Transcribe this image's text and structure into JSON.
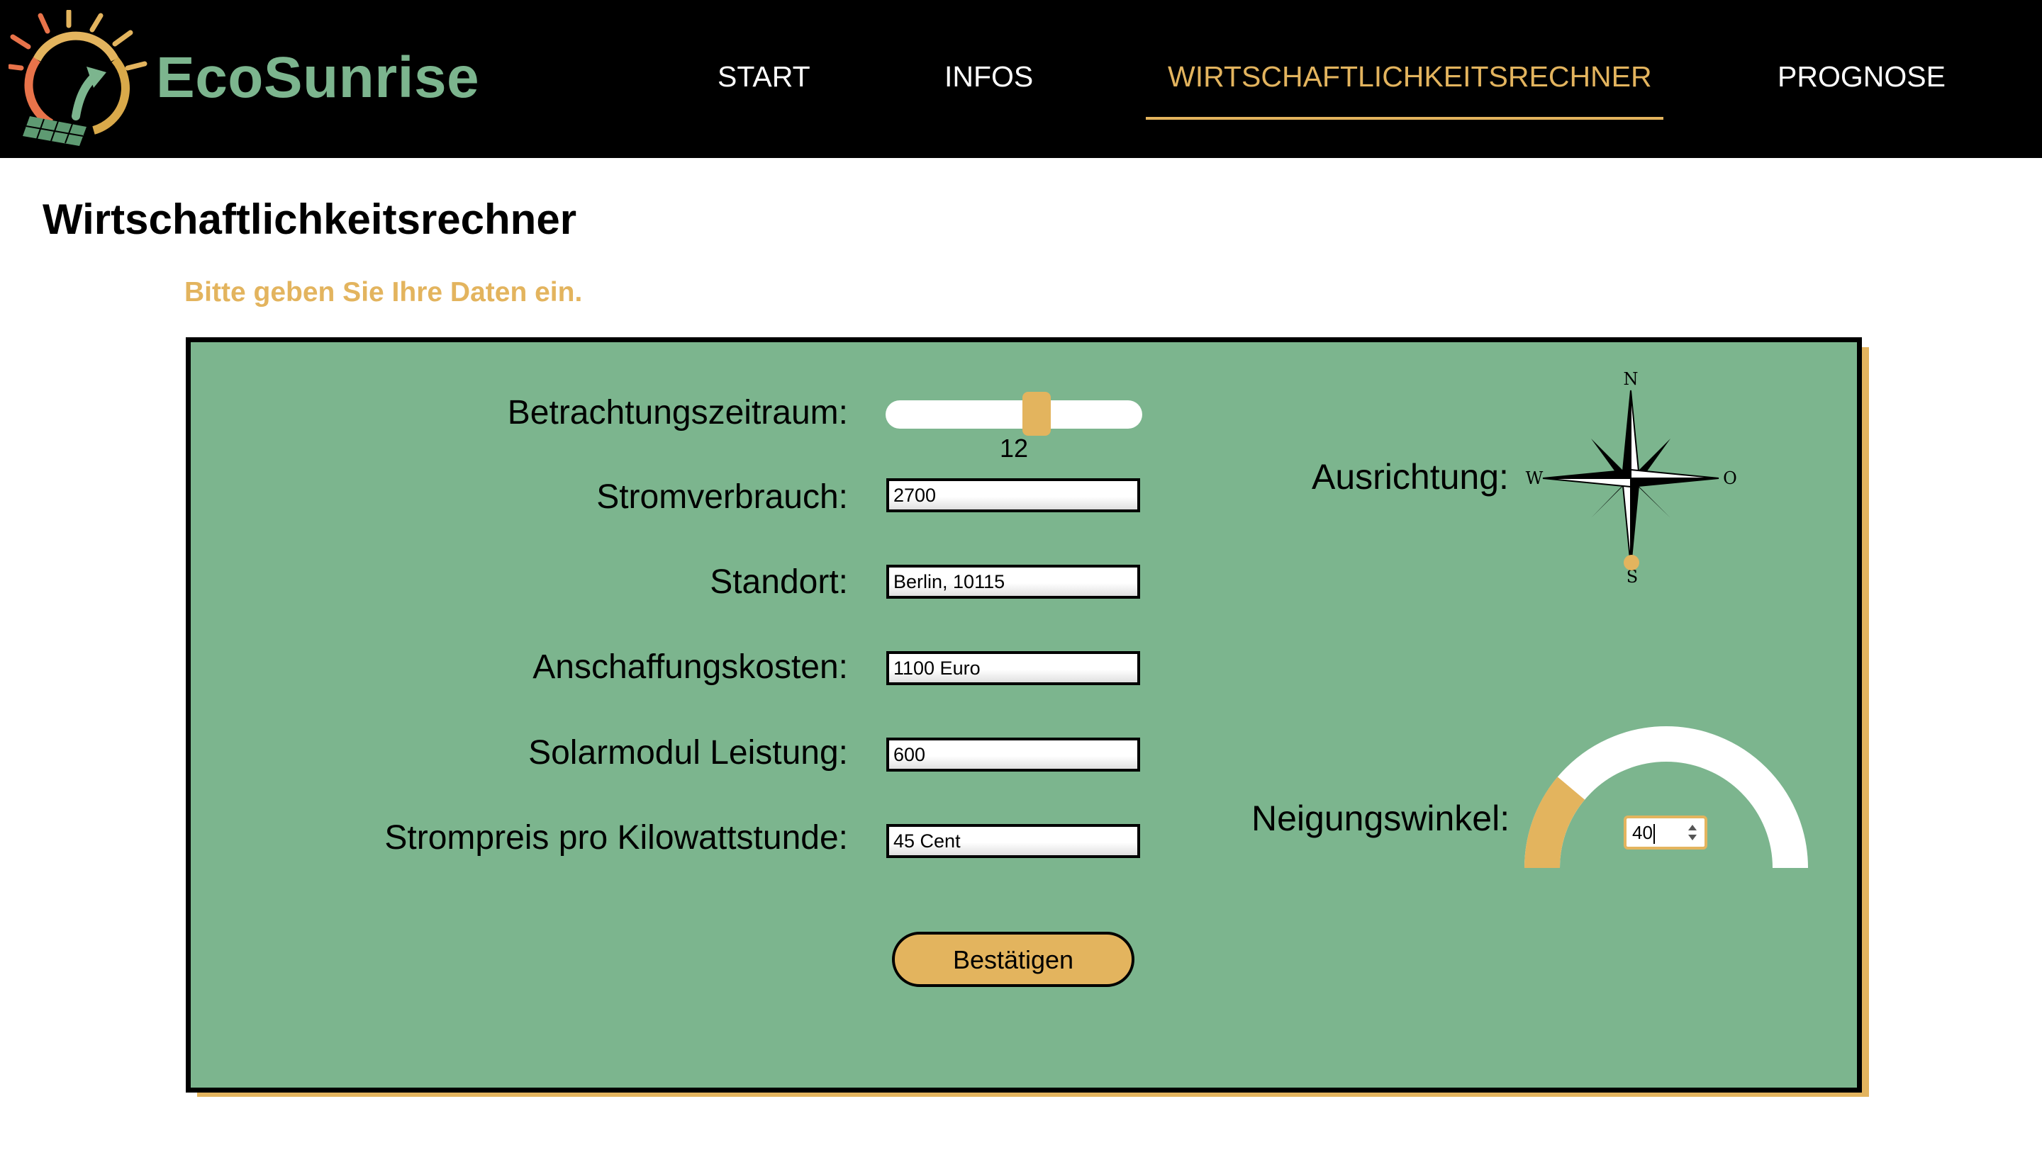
{
  "brand": {
    "name": "EcoSunrise"
  },
  "nav": {
    "items": [
      {
        "label": "START",
        "active": false
      },
      {
        "label": "INFOS",
        "active": false
      },
      {
        "label": "WIRTSCHAFTLICHKEITSRECHNER",
        "active": true
      },
      {
        "label": "PROGNOSE",
        "active": false
      }
    ]
  },
  "page": {
    "title": "Wirtschaftlichkeitsrechner",
    "subtitle": "Bitte geben Sie Ihre Daten ein."
  },
  "form": {
    "period": {
      "label": "Betrachtungszeitraum:",
      "value": "12",
      "fraction": 0.6
    },
    "consumption": {
      "label": "Stromverbrauch:",
      "value": "2700"
    },
    "location": {
      "label": "Standort:",
      "value": "Berlin, 10115"
    },
    "cost": {
      "label": "Anschaffungskosten:",
      "value": "1100 Euro"
    },
    "power": {
      "label": "Solarmodul Leistung:",
      "value": "600"
    },
    "price": {
      "label": "Strompreis pro Kilowattstunde:",
      "value": "45 Cent"
    },
    "submit_label": "Bestätigen"
  },
  "orientation": {
    "label": "Ausrichtung:",
    "directions": {
      "n": "N",
      "w": "W",
      "o": "O",
      "s": "S"
    },
    "selected": "S"
  },
  "tilt": {
    "label": "Neigungswinkel:",
    "value": "40",
    "max_degrees": 180
  },
  "colors": {
    "accent": "#e3b45e",
    "panel": "#7cb58e",
    "header": "#000000",
    "brand": "#7cb58e"
  },
  "icons": {
    "logo": "sun-circle-arrow-solar-panel-icon",
    "compass": "compass-rose-icon",
    "spinner": "spinner-arrows-icon"
  }
}
